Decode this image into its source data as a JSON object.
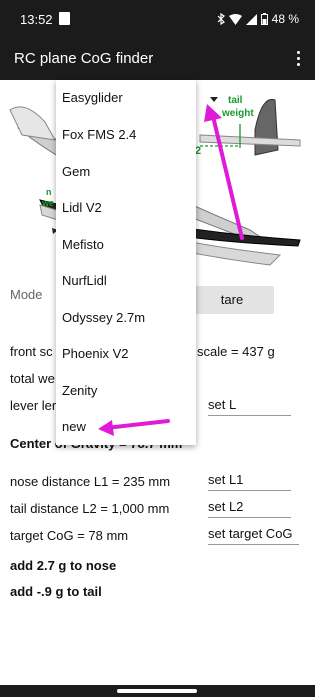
{
  "status_bar": {
    "time": "13:52",
    "battery": "48 %"
  },
  "app_bar": {
    "title": "RC plane CoG finder",
    "menu_icon": "more-vert-icon"
  },
  "diagram": {
    "tail_weight_label_1": "tail",
    "tail_weight_label_2": "weight",
    "l2_label": "2",
    "nose_weight_label_1": "n",
    "nose_weight_label_2": "we"
  },
  "dropdown": {
    "items": [
      "Easyglider",
      "Fox FMS 2.4",
      "Gem",
      "Lidl V2",
      "Mefisto",
      "NurfLidl",
      "Odyssey 2.7m",
      "Phoenix V2",
      "Zenity",
      "new"
    ]
  },
  "controls": {
    "mode_label": "Mode",
    "tare_label": "tare",
    "front_scale_prefix": "front sc",
    "front_scale_suffix": "scale = 437 g",
    "total_weight_prefix": "total we",
    "lever_prefix": "lever ler",
    "set_l_label": "set L",
    "cog_text": "Center of Gravity = 78.7 mm",
    "nose_distance": "nose distance L1 = 235 mm",
    "set_l1_label": "set L1",
    "tail_distance": "tail distance L2 = 1,000 mm",
    "set_l2_label": "set L2",
    "target_cog": "target CoG = 78 mm",
    "set_target_label": "set target CoG",
    "add_nose": "add 2.7 g  to nose",
    "add_tail": "add -.9 g  to tail"
  },
  "colors": {
    "bar_bg": "#1b1b1b",
    "annotation_arrow": "#e01bd8",
    "diagram_green": "#1a9a2a"
  }
}
